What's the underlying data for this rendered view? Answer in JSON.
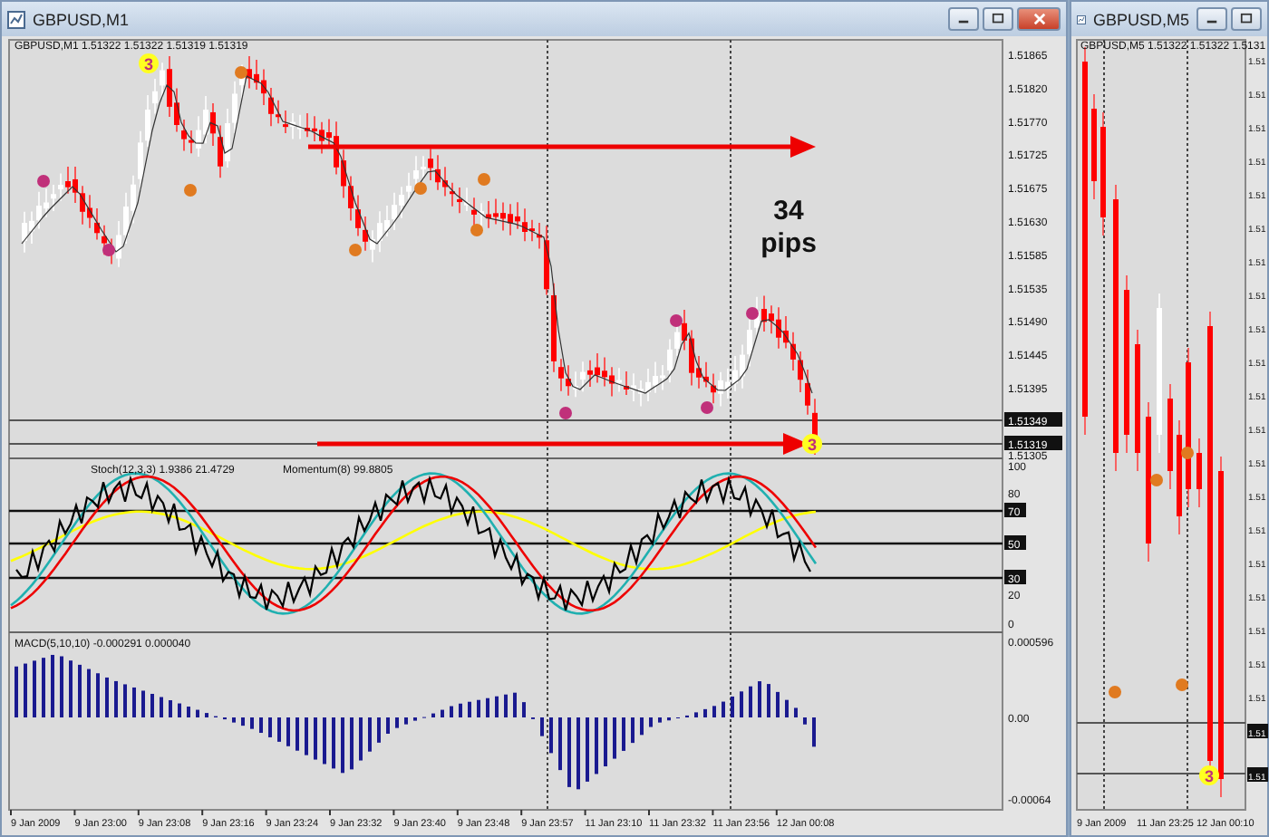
{
  "windows": [
    {
      "title": "GBPUSD,M1",
      "header": "GBPUSD,M1  1.51322 1.51322 1.51319 1.51319",
      "price_axis": [
        {
          "label": "1.51865",
          "kind": "tick"
        },
        {
          "label": "1.51820",
          "kind": "tick"
        },
        {
          "label": "1.51770",
          "kind": "tick"
        },
        {
          "label": "1.51725",
          "kind": "tick"
        },
        {
          "label": "1.51675",
          "kind": "tick"
        },
        {
          "label": "1.51630",
          "kind": "tick"
        },
        {
          "label": "1.51585",
          "kind": "tick"
        },
        {
          "label": "1.51535",
          "kind": "tick"
        },
        {
          "label": "1.51490",
          "kind": "tick"
        },
        {
          "label": "1.51445",
          "kind": "tick"
        },
        {
          "label": "1.51395",
          "kind": "tick"
        },
        {
          "label": "1.51349",
          "kind": "marker"
        },
        {
          "label": "1.51319",
          "kind": "marker"
        },
        {
          "label": "1.51305",
          "kind": "tick"
        }
      ],
      "signal_labels": [
        "3",
        "3"
      ],
      "annotation": "34 pips",
      "stoch_label": "Stoch(12,3,3) 1.9386 21.4729",
      "momentum_label": "Momentum(8) 99.8805",
      "stoch_axis": [
        {
          "label": "100",
          "kind": "tick"
        },
        {
          "label": "80",
          "kind": "tick"
        },
        {
          "label": "70",
          "kind": "marker"
        },
        {
          "label": "50",
          "kind": "marker"
        },
        {
          "label": "30",
          "kind": "marker"
        },
        {
          "label": "20",
          "kind": "tick"
        },
        {
          "label": "0",
          "kind": "tick"
        }
      ],
      "macd_label": "MACD(5,10,10) -0.000291 0.000040",
      "macd_axis": [
        "0.000596",
        "0.00",
        "-0.00064"
      ],
      "time_axis": [
        "9 Jan 2009",
        "9 Jan 23:00",
        "9 Jan 23:08",
        "9 Jan 23:16",
        "9 Jan 23:24",
        "9 Jan 23:32",
        "9 Jan 23:40",
        "9 Jan 23:48",
        "9 Jan 23:57",
        "11 Jan 23:10",
        "11 Jan 23:32",
        "11 Jan 23:56",
        "12 Jan 00:08"
      ]
    },
    {
      "title": "GBPUSD,M5",
      "header": "GBPUSD,M5  1.51322 1.51322 1.5131",
      "price_axis": [
        {
          "label": "1.51",
          "kind": "tick"
        },
        {
          "label": "1.51",
          "kind": "tick"
        },
        {
          "label": "1.51",
          "kind": "tick"
        },
        {
          "label": "1.51",
          "kind": "tick"
        },
        {
          "label": "1.51",
          "kind": "tick"
        },
        {
          "label": "1.51",
          "kind": "tick"
        },
        {
          "label": "1.51",
          "kind": "tick"
        },
        {
          "label": "1.51",
          "kind": "tick"
        },
        {
          "label": "1.51",
          "kind": "tick"
        },
        {
          "label": "1.51",
          "kind": "tick"
        },
        {
          "label": "1.51",
          "kind": "tick"
        },
        {
          "label": "1.51",
          "kind": "tick"
        },
        {
          "label": "1.51",
          "kind": "tick"
        },
        {
          "label": "1.51",
          "kind": "tick"
        },
        {
          "label": "1.51",
          "kind": "tick"
        },
        {
          "label": "1.51",
          "kind": "tick"
        },
        {
          "label": "1.51",
          "kind": "tick"
        },
        {
          "label": "1.51",
          "kind": "tick"
        },
        {
          "label": "1.51",
          "kind": "tick"
        },
        {
          "label": "1.51",
          "kind": "tick"
        },
        {
          "label": "1.51",
          "kind": "marker"
        },
        {
          "label": "1.51",
          "kind": "marker"
        }
      ],
      "signal_labels": [
        "3"
      ],
      "time_axis": [
        "9 Jan 2009",
        "11 Jan 23:25",
        "12 Jan 00:10"
      ]
    }
  ]
}
